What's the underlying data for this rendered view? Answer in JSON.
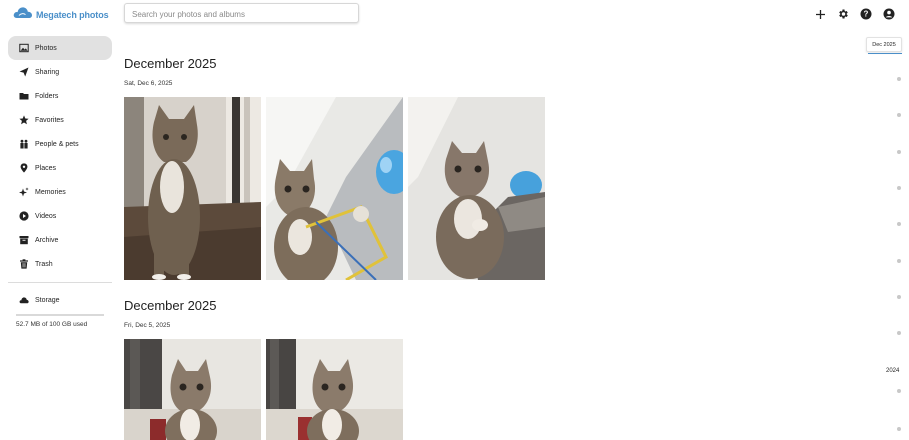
{
  "app": {
    "name": "Megatech photos",
    "brand_color": "#4a8fc9"
  },
  "search": {
    "placeholder": "Search your photos and albums",
    "value": ""
  },
  "top_actions": [
    {
      "name": "add-icon"
    },
    {
      "name": "settings-icon"
    },
    {
      "name": "help-icon"
    },
    {
      "name": "account-icon"
    }
  ],
  "sidebar": {
    "items": [
      {
        "label": "Photos",
        "icon": "photos-icon",
        "active": true
      },
      {
        "label": "Sharing",
        "icon": "sharing-icon"
      },
      {
        "label": "Folders",
        "icon": "folders-icon"
      },
      {
        "label": "Favorites",
        "icon": "star-icon"
      },
      {
        "label": "People & pets",
        "icon": "people-icon"
      },
      {
        "label": "Places",
        "icon": "place-pin-icon"
      },
      {
        "label": "Memories",
        "icon": "sparkle-icon"
      },
      {
        "label": "Videos",
        "icon": "play-icon"
      },
      {
        "label": "Archive",
        "icon": "archive-icon"
      },
      {
        "label": "Trash",
        "icon": "trash-icon"
      }
    ],
    "storage": {
      "label": "Storage",
      "icon": "cloud-icon",
      "usage_text": "52.7 MB of 100 GB used",
      "used_fraction": 0.0005
    }
  },
  "groups": [
    {
      "title": "December 2025",
      "date": "Sat, Dec 6, 2025",
      "photo_count": 3
    },
    {
      "title": "December 2025",
      "date": "Fri, Dec 5, 2025",
      "photo_count": 2
    }
  ],
  "timeline": {
    "current_label": "Dec 2025",
    "year_label": "2024"
  }
}
